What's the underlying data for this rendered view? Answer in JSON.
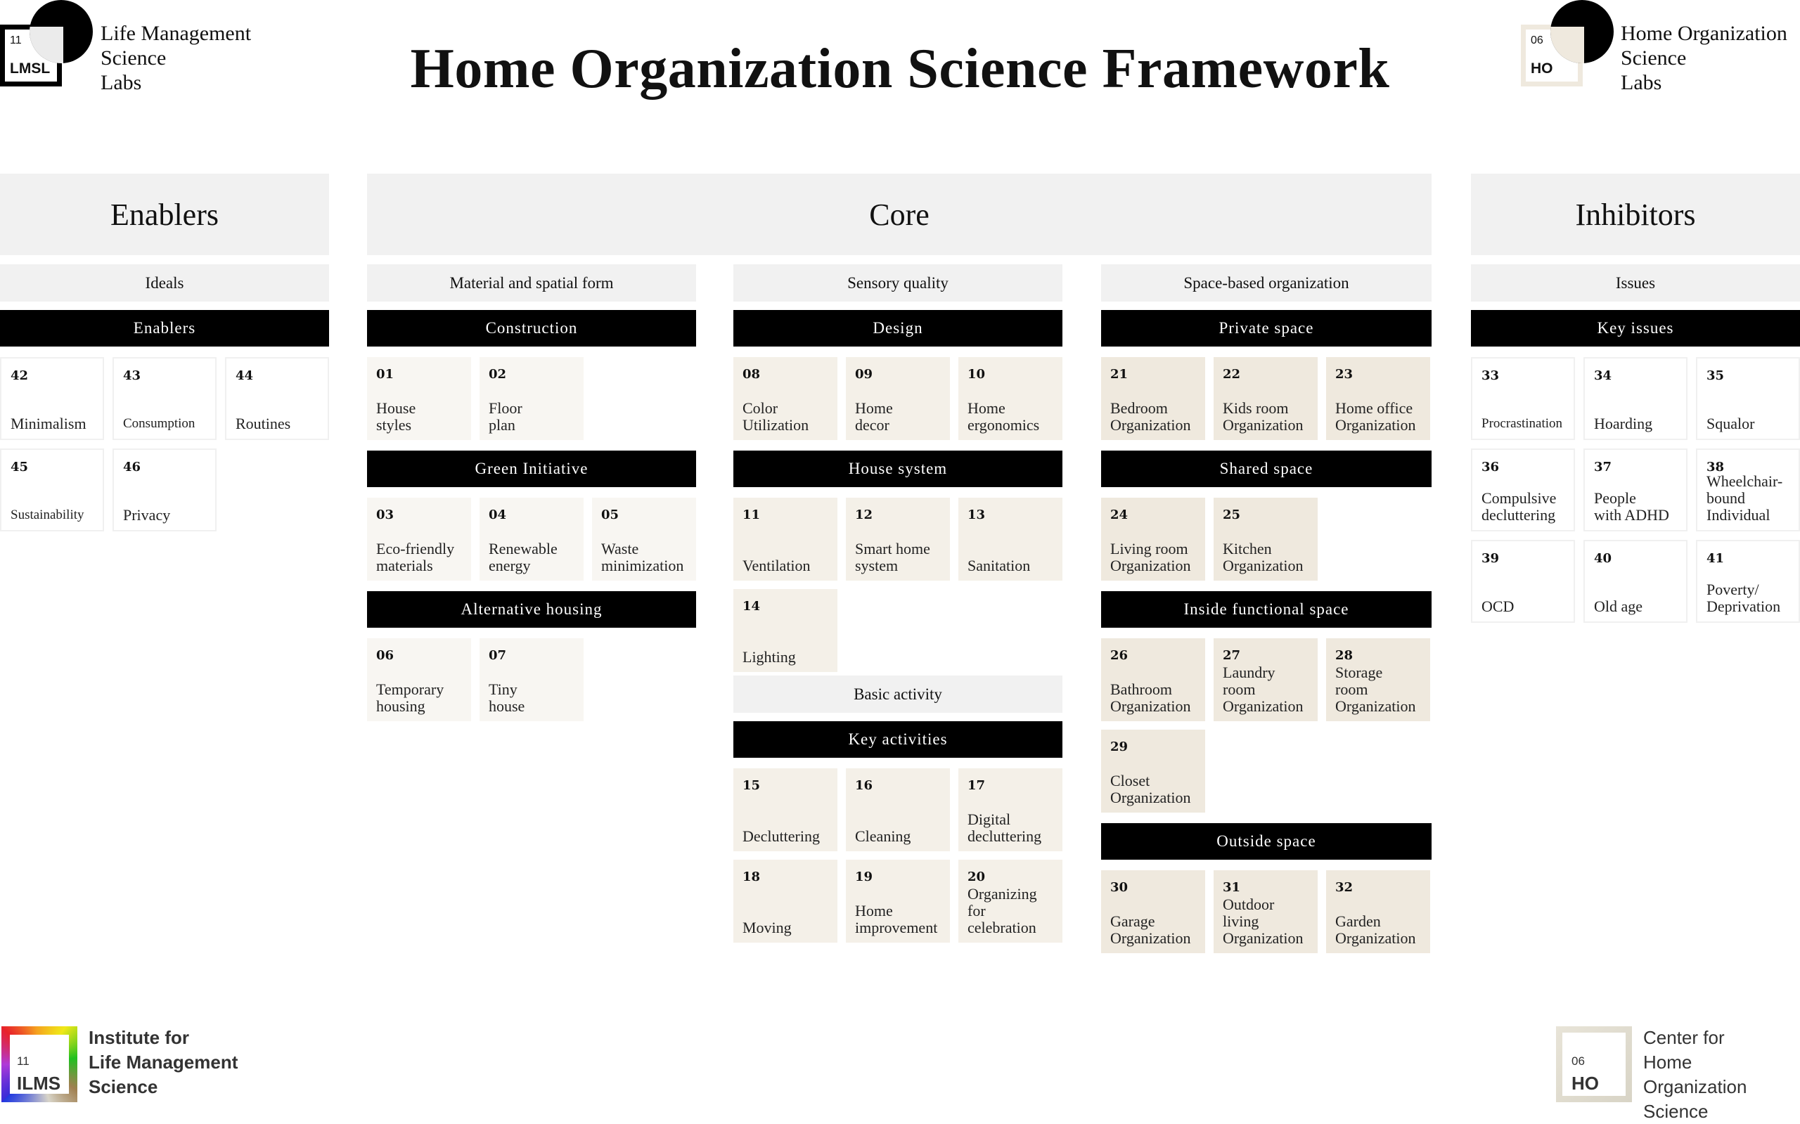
{
  "header": {
    "title": "Home Organization Science Framework",
    "logo_left": {
      "number": "11",
      "code": "LMSL",
      "name_lines": [
        "Life Management",
        "Science",
        "Labs"
      ]
    },
    "logo_right": {
      "number": "06",
      "code": "HO",
      "name_lines": [
        "Home Organization",
        "Science",
        "Labs"
      ]
    }
  },
  "colors": {
    "section_header_bg": "#f1f1f1",
    "band_bg": "#000000",
    "tile_material": "#f8f6f2",
    "tile_sensory": "#f4f0e8",
    "tile_space": "#efe9de",
    "tile_white_border": "#f0f0f0"
  },
  "enablers": {
    "title": "Enablers",
    "sub_header": "Ideals",
    "groups": [
      {
        "band": "Enablers",
        "items": [
          {
            "num": "42",
            "label": "Minimalism"
          },
          {
            "num": "43",
            "label": "Consumption"
          },
          {
            "num": "44",
            "label": "Routines"
          },
          {
            "num": "45",
            "label": "Sustainability"
          },
          {
            "num": "46",
            "label": "Privacy"
          }
        ]
      }
    ]
  },
  "core": {
    "title": "Core",
    "columns": [
      {
        "sub_header": "Material and spatial form",
        "groups": [
          {
            "band": "Construction",
            "items": [
              {
                "num": "01",
                "label": "House\nstyles"
              },
              {
                "num": "02",
                "label": "Floor\nplan"
              }
            ]
          },
          {
            "band": "Green Initiative",
            "items": [
              {
                "num": "03",
                "label": "Eco-friendly\nmaterials"
              },
              {
                "num": "04",
                "label": "Renewable\nenergy"
              },
              {
                "num": "05",
                "label": "Waste\nminimization"
              }
            ]
          },
          {
            "band": "Alternative housing",
            "items": [
              {
                "num": "06",
                "label": "Temporary\nhousing"
              },
              {
                "num": "07",
                "label": "Tiny\nhouse"
              }
            ]
          }
        ]
      },
      {
        "sub_header": "Sensory quality",
        "groups": [
          {
            "band": "Design",
            "items": [
              {
                "num": "08",
                "label": "Color\nUtilization"
              },
              {
                "num": "09",
                "label": "Home\ndecor"
              },
              {
                "num": "10",
                "label": "Home\nergonomics"
              }
            ]
          },
          {
            "band": "House system",
            "items": [
              {
                "num": "11",
                "label": "Ventilation"
              },
              {
                "num": "12",
                "label": "Smart home\nsystem"
              },
              {
                "num": "13",
                "label": "Sanitation"
              },
              {
                "num": "14",
                "label": "Lighting"
              }
            ]
          }
        ]
      },
      {
        "sub_header": "Basic activity",
        "groups": [
          {
            "band": "Key activities",
            "items": [
              {
                "num": "15",
                "label": "Decluttering"
              },
              {
                "num": "16",
                "label": "Cleaning"
              },
              {
                "num": "17",
                "label": "Digital\ndecluttering"
              },
              {
                "num": "18",
                "label": "Moving"
              },
              {
                "num": "19",
                "label": "Home\nimprovement"
              },
              {
                "num": "20",
                "label": "Organizing\nfor\ncelebration"
              }
            ]
          }
        ]
      },
      {
        "sub_header": "Space-based organization",
        "groups": [
          {
            "band": "Private space",
            "items": [
              {
                "num": "21",
                "label": "Bedroom\nOrganization"
              },
              {
                "num": "22",
                "label": "Kids room\nOrganization"
              },
              {
                "num": "23",
                "label": "Home office\nOrganization"
              }
            ]
          },
          {
            "band": "Shared space",
            "items": [
              {
                "num": "24",
                "label": "Living room\nOrganization"
              },
              {
                "num": "25",
                "label": "Kitchen\nOrganization"
              }
            ]
          },
          {
            "band": "Inside functional space",
            "items": [
              {
                "num": "26",
                "label": "Bathroom\nOrganization"
              },
              {
                "num": "27",
                "label": "Laundry\nroom\nOrganization"
              },
              {
                "num": "28",
                "label": "Storage\nroom\nOrganization"
              },
              {
                "num": "29",
                "label": "Closet\nOrganization"
              }
            ]
          },
          {
            "band": "Outside space",
            "items": [
              {
                "num": "30",
                "label": "Garage\nOrganization"
              },
              {
                "num": "31",
                "label": "Outdoor\nliving\nOrganization"
              },
              {
                "num": "32",
                "label": "Garden\nOrganization"
              }
            ]
          }
        ]
      }
    ]
  },
  "inhibitors": {
    "title": "Inhibitors",
    "sub_header": "Issues",
    "groups": [
      {
        "band": "Key issues",
        "items": [
          {
            "num": "33",
            "label": "Procrastination"
          },
          {
            "num": "34",
            "label": "Hoarding"
          },
          {
            "num": "35",
            "label": "Squalor"
          },
          {
            "num": "36",
            "label": "Compulsive\ndecluttering"
          },
          {
            "num": "37",
            "label": "People\nwith ADHD"
          },
          {
            "num": "38",
            "label": "Wheelchair-\nbound\nIndividual"
          },
          {
            "num": "39",
            "label": "OCD"
          },
          {
            "num": "40",
            "label": "Old age"
          },
          {
            "num": "41",
            "label": "Poverty/\nDeprivation"
          }
        ]
      }
    ]
  },
  "footer": {
    "left": {
      "number": "11",
      "code": "ILMS",
      "name_lines": [
        "Institute for",
        "Life Management",
        "Science"
      ]
    },
    "right": {
      "number": "06",
      "code": "HO",
      "name_lines": [
        "Center for",
        "Home Organization",
        "Science"
      ]
    }
  }
}
